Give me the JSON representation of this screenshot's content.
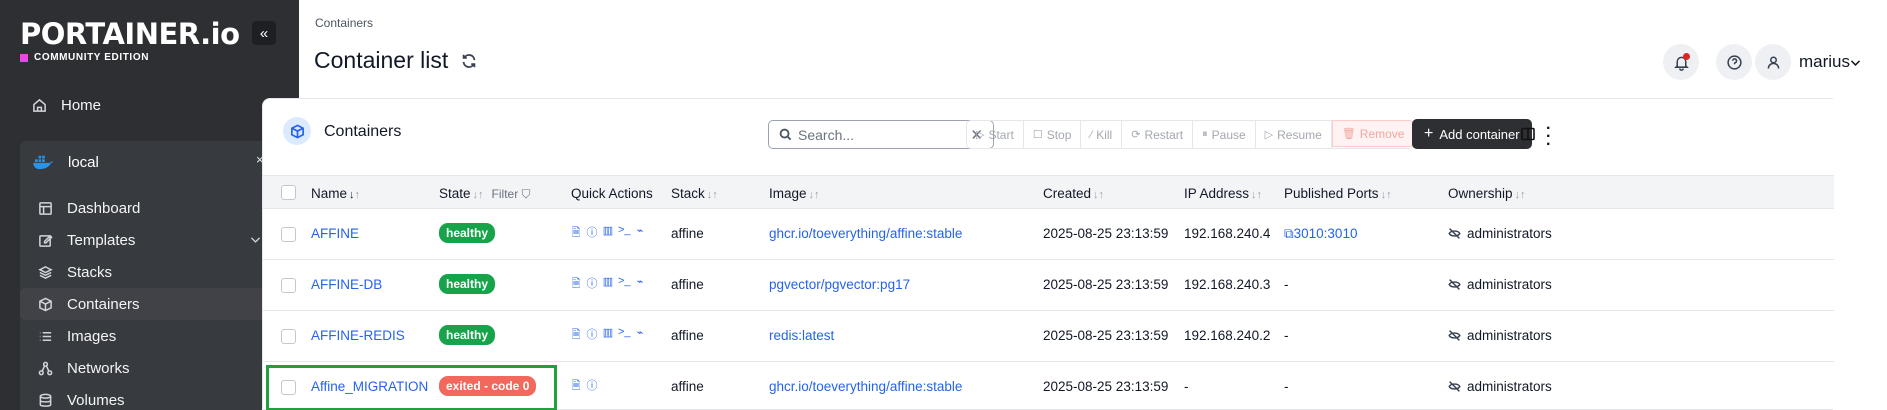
{
  "app": {
    "logo": "PORTAINER.io",
    "edition": "COMMUNITY EDITION",
    "collapse": "«"
  },
  "sidebar": {
    "home": "Home",
    "environment": {
      "name": "local",
      "close": "×"
    },
    "items": [
      {
        "label": "Dashboard",
        "icon": "dashboard-icon"
      },
      {
        "label": "Templates",
        "icon": "edit-icon",
        "expandable": true
      },
      {
        "label": "Stacks",
        "icon": "layers-icon"
      },
      {
        "label": "Containers",
        "icon": "box-icon",
        "active": true
      },
      {
        "label": "Images",
        "icon": "list-icon"
      },
      {
        "label": "Networks",
        "icon": "network-icon"
      },
      {
        "label": "Volumes",
        "icon": "database-icon"
      }
    ]
  },
  "header": {
    "breadcrumb": "Containers",
    "title": "Container list",
    "user": "marius"
  },
  "card": {
    "title": "Containers",
    "search_placeholder": "Search...",
    "actions": [
      "Start",
      "Stop",
      "Kill",
      "Restart",
      "Pause",
      "Resume",
      "Remove"
    ],
    "add_button": "Add container"
  },
  "table": {
    "columns": [
      "Name",
      "State",
      "Quick Actions",
      "Stack",
      "Image",
      "Created",
      "IP Address",
      "Published Ports",
      "Ownership"
    ],
    "filter_label": "Filter",
    "rows": [
      {
        "name": "AFFINE",
        "state": "healthy",
        "stack": "affine",
        "image": "ghcr.io/toeverything/affine:stable",
        "created": "2025-08-25 23:13:59",
        "ip": "192.168.240.4",
        "ports": "3010:3010",
        "ownership": "administrators"
      },
      {
        "name": "AFFINE-DB",
        "state": "healthy",
        "stack": "affine",
        "image": "pgvector/pgvector:pg17",
        "created": "2025-08-25 23:13:59",
        "ip": "192.168.240.3",
        "ports": "-",
        "ownership": "administrators"
      },
      {
        "name": "AFFINE-REDIS",
        "state": "healthy",
        "stack": "affine",
        "image": "redis:latest",
        "created": "2025-08-25 23:13:59",
        "ip": "192.168.240.2",
        "ports": "-",
        "ownership": "administrators"
      },
      {
        "name": "Affine_MIGRATION",
        "state": "exited - code 0",
        "stack": "affine",
        "image": "ghcr.io/toeverything/affine:stable",
        "created": "2025-08-25 23:13:59",
        "ip": "-",
        "ports": "-",
        "ownership": "administrators"
      }
    ]
  },
  "colors": {
    "sidebar_bg": "#2d2f33",
    "link": "#2563eb",
    "healthy": "#16a34a",
    "exited": "#f2685c",
    "highlight": "#22a03e"
  }
}
